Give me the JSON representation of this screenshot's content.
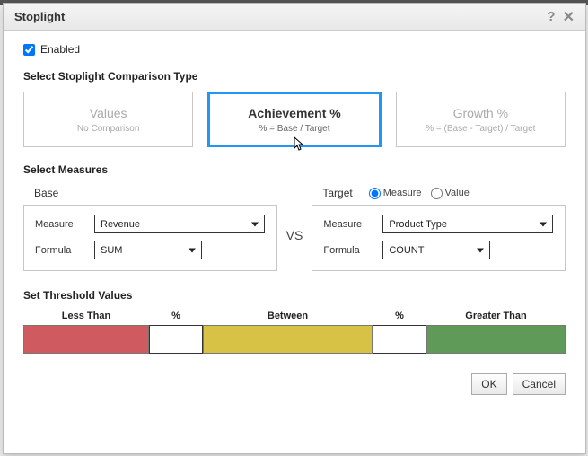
{
  "dialog": {
    "title": "Stoplight"
  },
  "enabled": {
    "label": "Enabled",
    "checked": true
  },
  "sections": {
    "type_label": "Select Stoplight Comparison Type",
    "measures_label": "Select Measures",
    "threshold_label": "Set Threshold Values"
  },
  "types": [
    {
      "id": "values",
      "title": "Values",
      "sub": "No Comparison",
      "selected": false
    },
    {
      "id": "achievement",
      "title": "Achievement %",
      "sub": "% = Base / Target",
      "selected": true
    },
    {
      "id": "growth",
      "title": "Growth %",
      "sub": "% = (Base - Target) / Target",
      "selected": false
    }
  ],
  "measures": {
    "base_label": "Base",
    "target_label": "Target",
    "vs_label": "VS",
    "target_mode": {
      "options": [
        "Measure",
        "Value"
      ],
      "selected": "Measure"
    },
    "measure_field_label": "Measure",
    "formula_field_label": "Formula",
    "base": {
      "measure": "Revenue",
      "formula": "SUM"
    },
    "target": {
      "measure": "Product Type",
      "formula": "COUNT"
    }
  },
  "threshold": {
    "less_than_label": "Less Than",
    "percent_label": "%",
    "between_label": "Between",
    "greater_than_label": "Greater Than",
    "low_value": "",
    "high_value": "",
    "colors": {
      "low": "#cf5b60",
      "mid": "#d7c246",
      "high": "#5f9a59"
    }
  },
  "buttons": {
    "ok": "OK",
    "cancel": "Cancel"
  }
}
